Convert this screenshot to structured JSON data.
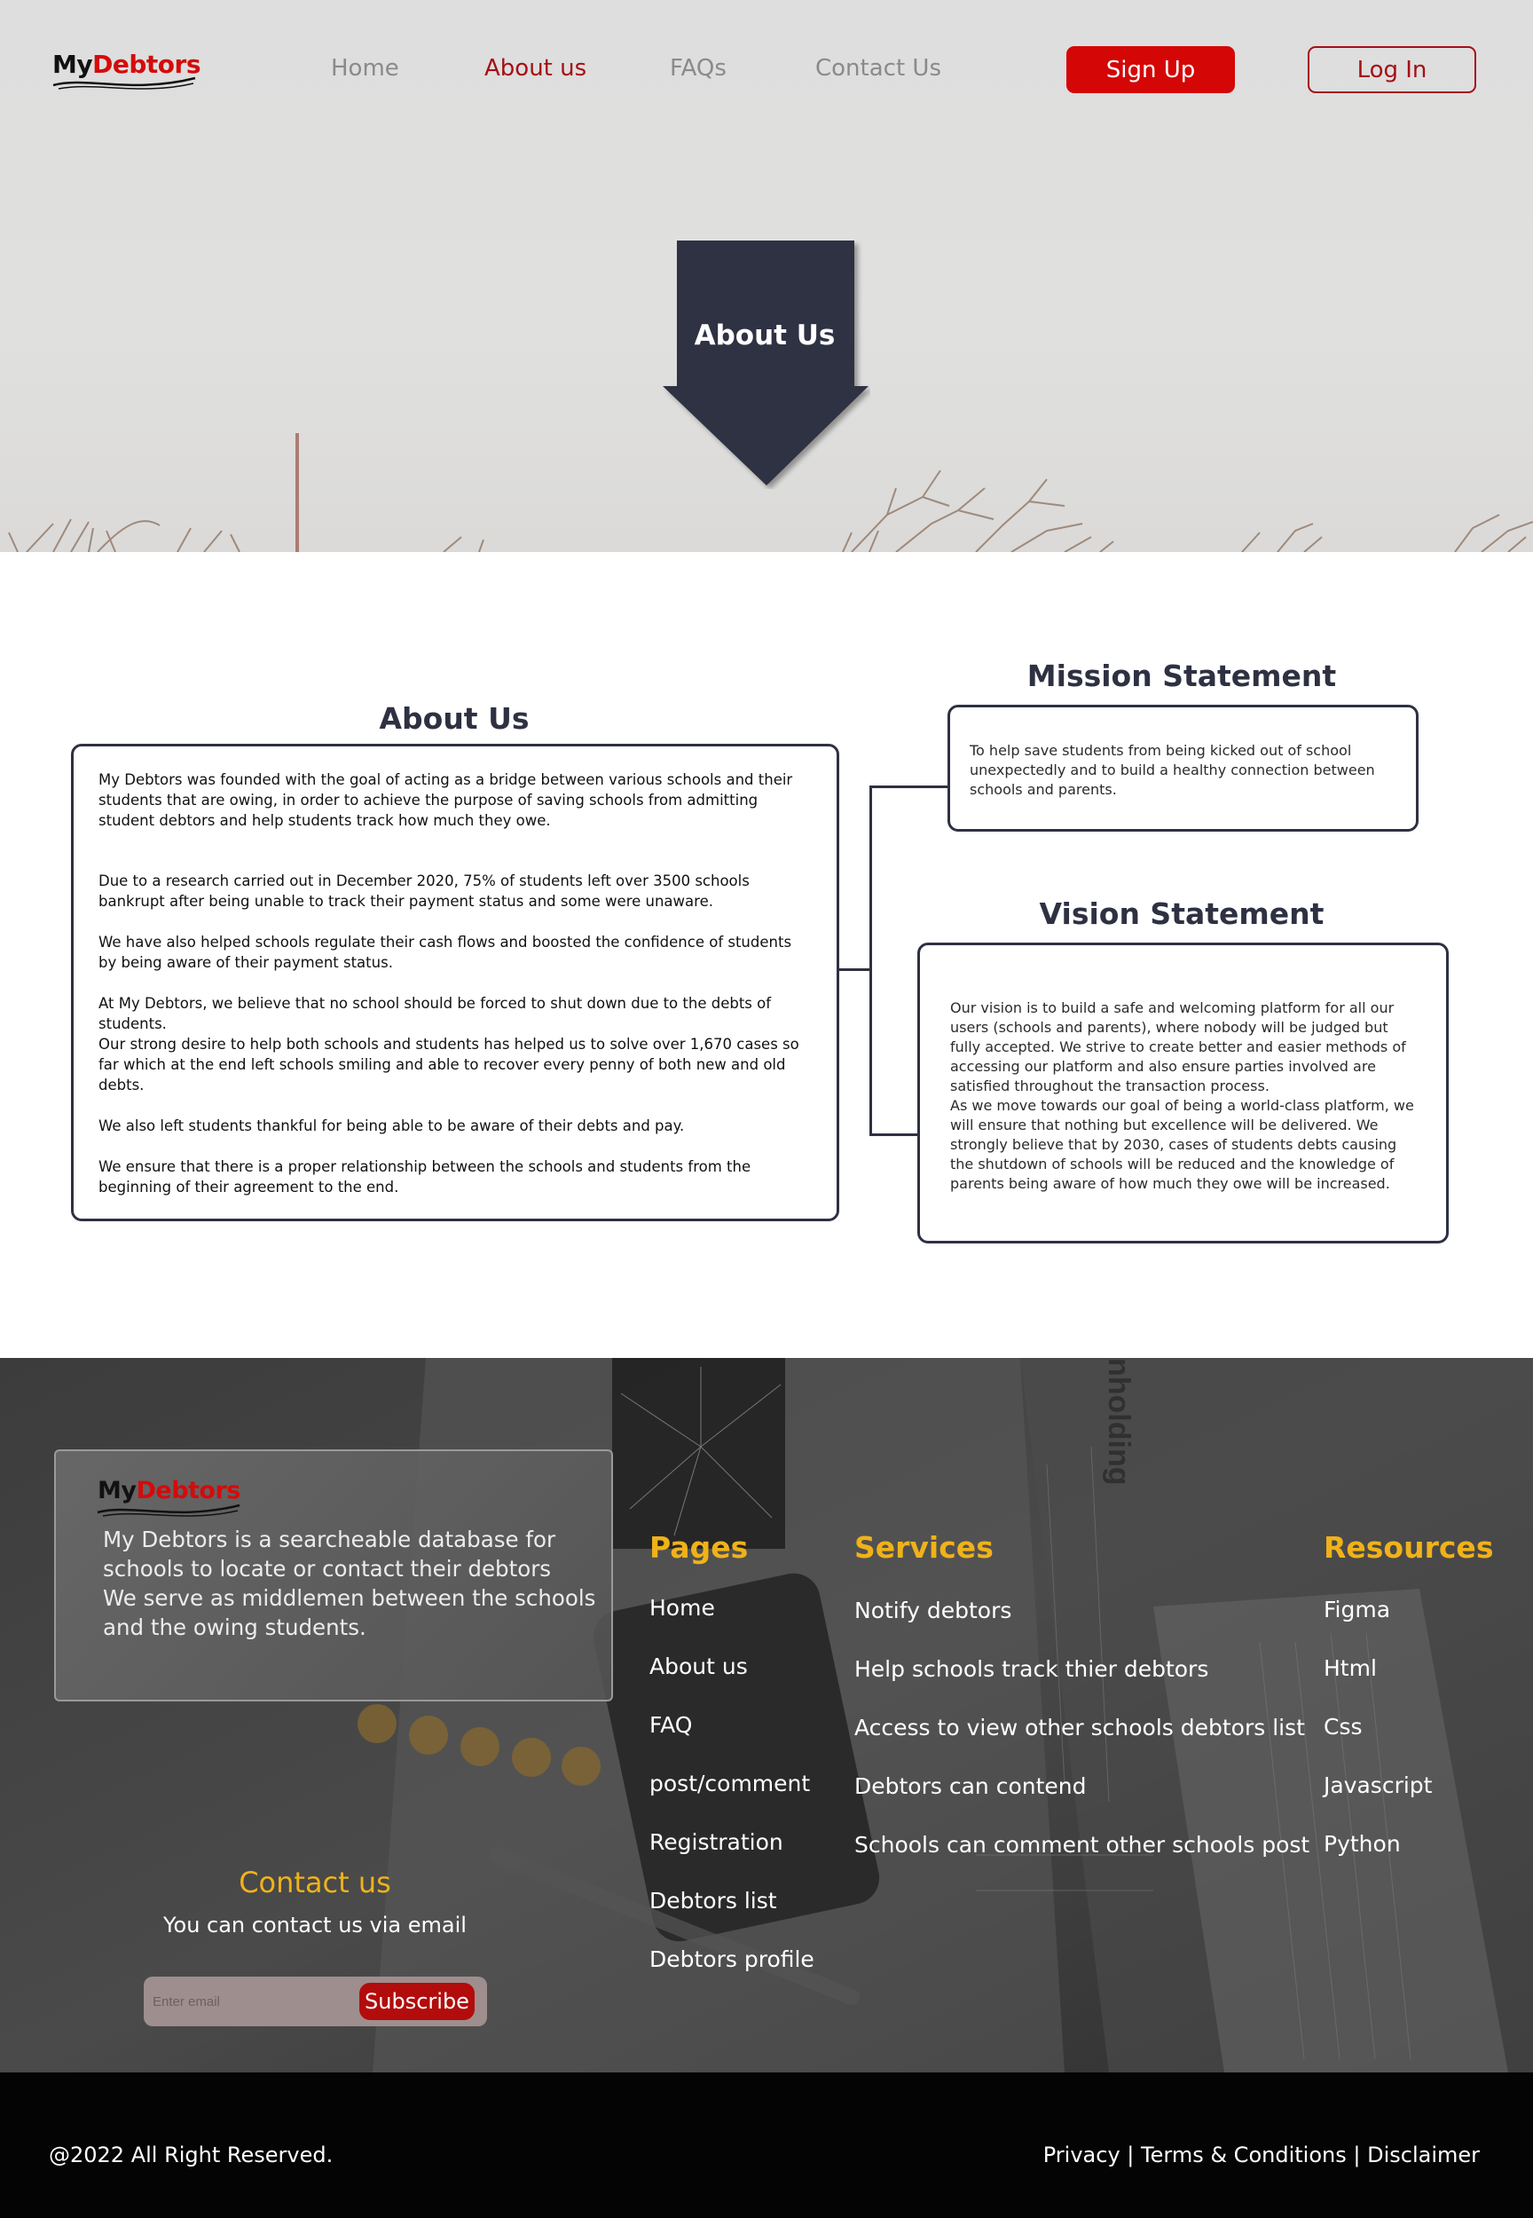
{
  "brand": {
    "my": "My",
    "debtors": "Debtors",
    "accent": "#d40b0b"
  },
  "nav": {
    "links": [
      "Home",
      "About us",
      "FAQs",
      "Contact Us"
    ],
    "active": "About us",
    "signup": "Sign Up",
    "login": "Log In"
  },
  "hero": {
    "title": "About Us"
  },
  "about": {
    "heading": "About Us",
    "paragraphs": [
      "My Debtors was founded with the goal of acting as a bridge between various schools and their students that are owing, in order to achieve the purpose of saving schools from admitting student debtors and help students track how much they owe.",
      "Due to a research carried out in December 2020, 75% of students left over 3500 schools bankrupt after being unable to track their payment status and some were unaware.",
      "We have also helped schools regulate their cash flows and boosted the confidence of students by being aware of their payment status.",
      "At My Debtors, we believe that no school should be forced to shut down due to the debts of students.",
      "Our strong desire to help both schools and students has helped us to solve over 1,670 cases so far which at the end left schools smiling and able to recover every penny of both new and old debts.",
      "We also left students thankful for being able to be aware of their debts and pay.",
      "We ensure that there is a proper relationship between the schools and students from the beginning of their agreement to the end."
    ]
  },
  "mission": {
    "heading": "Mission Statement",
    "text": "To help save students from being kicked out of school unexpectedly and to build a healthy connection between schools and parents."
  },
  "vision": {
    "heading": "Vision Statement",
    "text1": "Our vision is to build a safe and welcoming platform for all our users (schools and parents), where nobody will be judged but fully accepted. We strive to create better and easier methods of accessing our platform and also ensure parties involved are satisfied throughout the transaction process.",
    "text2": "As we move towards our goal of being a world-class platform, we will ensure that nothing but excellence will be delivered. We strongly believe that by 2030, cases of students debts causing the shutdown of schools will be reduced and the knowledge of parents being aware of how much they owe will be increased."
  },
  "footer": {
    "description1": "My Debtors is a searcheable database for schools to locate or contact their debtors",
    "description2": "We serve as middlemen between the schools and the owing students.",
    "pages": {
      "title": "Pages",
      "links": [
        "Home",
        "About us",
        "FAQ",
        "post/comment",
        "Registration",
        "Debtors list",
        "Debtors profile"
      ]
    },
    "services": {
      "title": "Services",
      "links": [
        "Notify debtors",
        "Help schools track thier debtors",
        "Access to view other schools debtors list",
        "Debtors can contend",
        "Schools can comment other schools post"
      ]
    },
    "resources": {
      "title": "Resources",
      "links": [
        "Figma",
        "Html",
        "Css",
        "Javascript",
        "Python"
      ]
    },
    "contact": {
      "title": "Contact us",
      "subtitle": "You can contact us via email",
      "placeholder": "Enter email",
      "button": "Subscribe"
    },
    "accent": "#f0b21a"
  },
  "bottom": {
    "copyright": "@2022 All Right Reserved.",
    "privacy": "Privacy",
    "terms": "Terms & Conditions",
    "disclaimer": "Disclaimer",
    "separator": "|"
  }
}
